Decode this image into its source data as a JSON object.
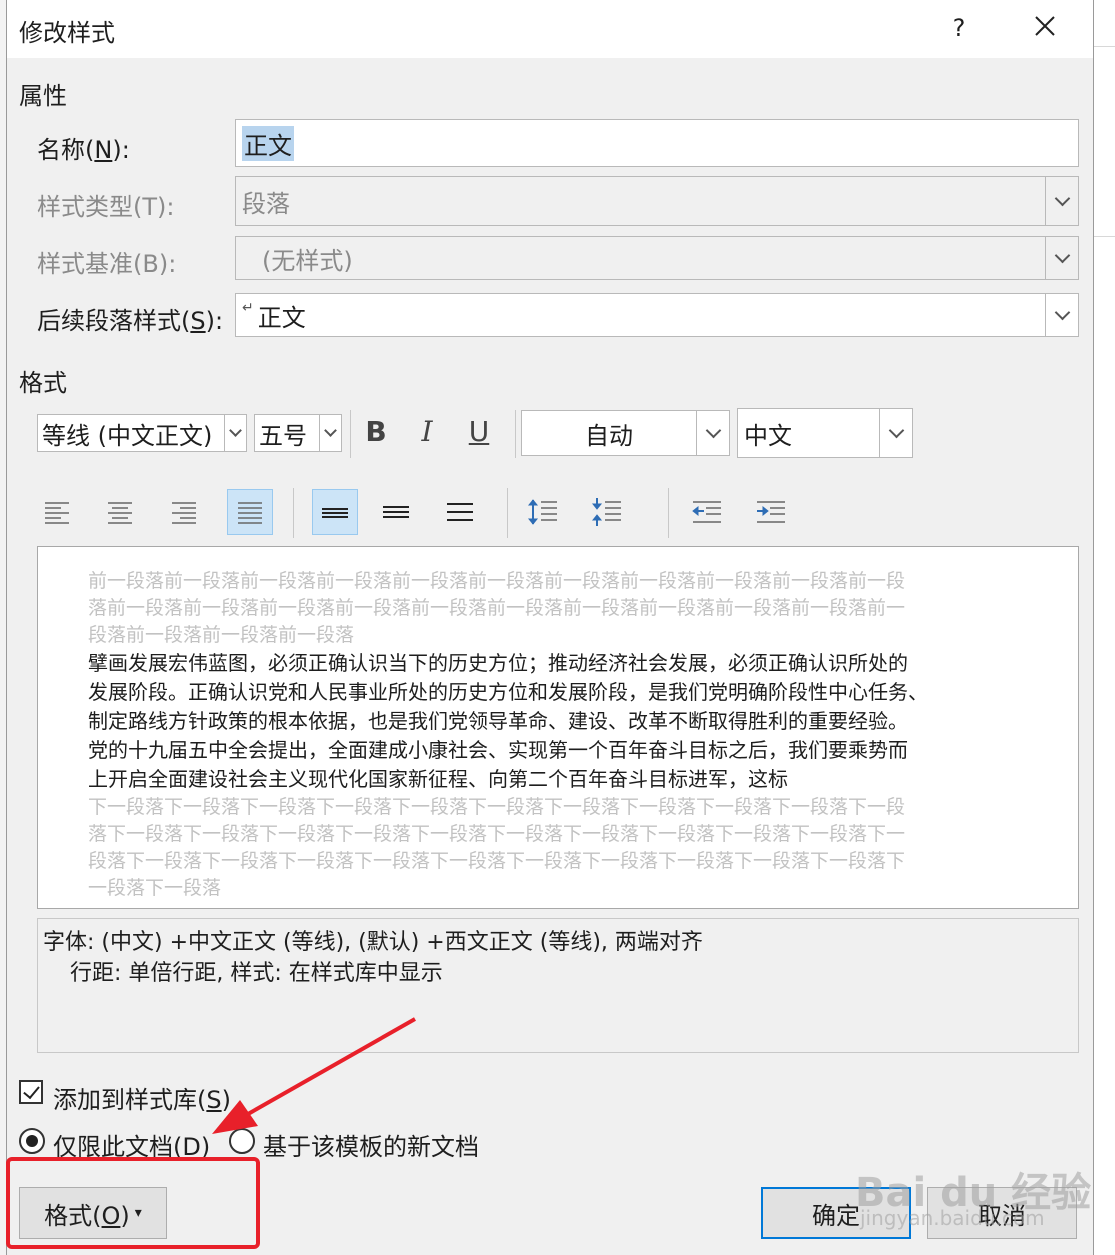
{
  "dialog": {
    "title": "修改样式",
    "help": "?",
    "close": "✕"
  },
  "properties": {
    "section": "属性",
    "name_label": "名称(N):",
    "name_value": "正文",
    "type_label": "样式类型(T):",
    "type_value": "段落",
    "base_label": "样式基准(B):",
    "base_value": "(无样式)",
    "next_label": "后续段落样式(S):",
    "next_value": "正文",
    "next_mark": "↵"
  },
  "format": {
    "section": "格式",
    "font": "等线 (中文正文)",
    "size": "五号",
    "bold": "B",
    "italic": "I",
    "underline": "U",
    "color": "自动",
    "script": "中文"
  },
  "preview": {
    "prev_lines": [
      "前一段落前一段落前一段落前一段落前一段落前一段落前一段落前一段落前一段落前一段落前一段",
      "落前一段落前一段落前一段落前一段落前一段落前一段落前一段落前一段落前一段落前一段落前一",
      "段落前一段落前一段落前一段落"
    ],
    "main_lines": [
      "擘画发展宏伟蓝图，必须正确认识当下的历史方位；推动经济社会发展，必须正确认识所处的",
      "发展阶段。正确认识党和人民事业所处的历史方位和发展阶段，是我们党明确阶段性中心任务、",
      "制定路线方针政策的根本依据，也是我们党领导革命、建设、改革不断取得胜利的重要经验。",
      "党的十九届五中全会提出，全面建成小康社会、实现第一个百年奋斗目标之后，我们要乘势而",
      "上开启全面建设社会主义现代化国家新征程、向第二个百年奋斗目标进军，这标"
    ],
    "next_lines": [
      "下一段落下一段落下一段落下一段落下一段落下一段落下一段落下一段落下一段落下一段落下一段",
      "落下一段落下一段落下一段落下一段落下一段落下一段落下一段落下一段落下一段落下一段落下一",
      "段落下一段落下一段落下一段落下一段落下一段落下一段落下一段落下一段落下一段落下一段落下",
      "一段落下一段落"
    ]
  },
  "description": {
    "line1": "字体: (中文) +中文正文 (等线), (默认) +西文正文 (等线), 两端对齐",
    "line2": "行距: 单倍行距, 样式: 在样式库中显示"
  },
  "options": {
    "add_to_gallery": "添加到样式库(S)",
    "only_this_doc": "仅限此文档(D)",
    "new_docs": "基于该模板的新文档"
  },
  "buttons": {
    "format": "格式(O)",
    "format_arrow": "▾",
    "ok": "确定",
    "cancel": "取消"
  },
  "watermark": {
    "logo": "Bai du 经验",
    "url": "jingyan.baidu.com"
  }
}
